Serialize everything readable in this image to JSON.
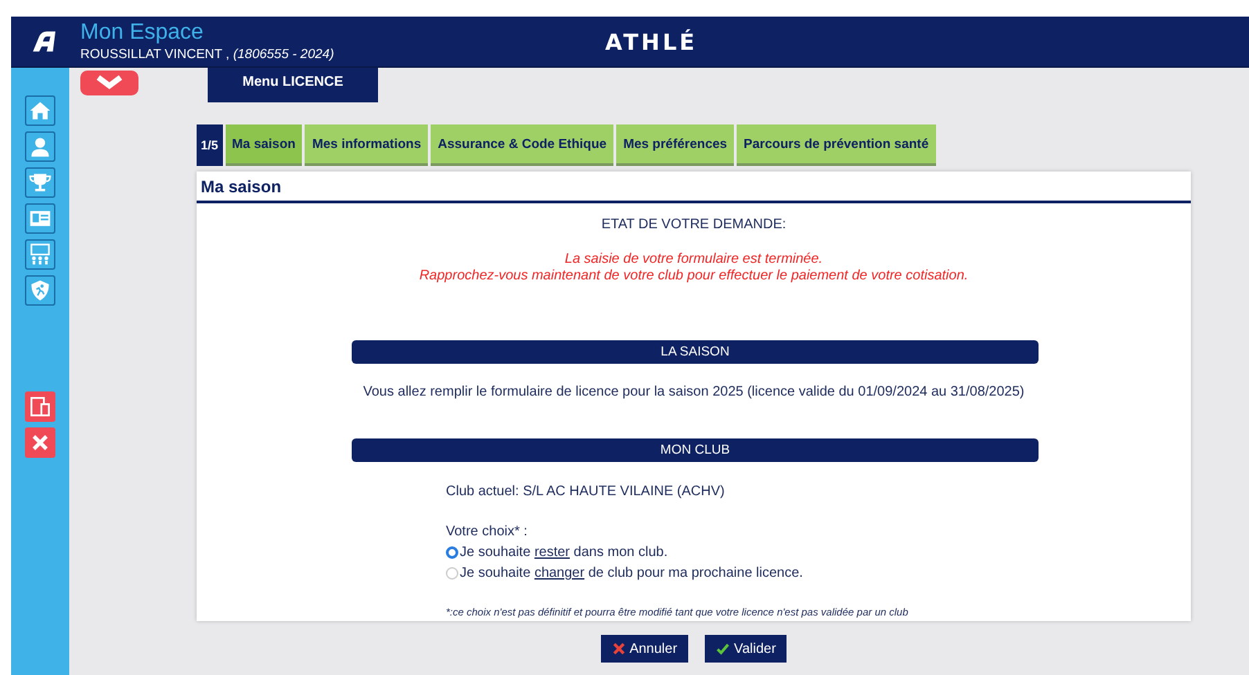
{
  "header": {
    "title": "Mon Espace",
    "user": "ROUSSILLAT VINCENT ,",
    "user_id": "(1806555 - 2024)",
    "logo": "ATHLÉ"
  },
  "menu_button": "Menu LICENCE",
  "step": "1/5",
  "tabs": [
    {
      "label": "Ma saison",
      "selected": true
    },
    {
      "label": "Mes informations",
      "selected": false
    },
    {
      "label": "Assurance & Code Ethique",
      "selected": false
    },
    {
      "label": "Mes préférences",
      "selected": false
    },
    {
      "label": "Parcours de prévention santé",
      "selected": false
    }
  ],
  "panel": {
    "title": "Ma saison",
    "status_heading": "ETAT DE VOTRE DEMANDE:",
    "status_lines": [
      "La saisie de votre formulaire est terminée.",
      "Rapprochez-vous maintenant de votre club pour effectuer le paiement de votre cotisation."
    ],
    "season_heading": "LA SAISON",
    "season_text": "Vous allez remplir le formulaire de licence pour la saison 2025 (licence valide du 01/09/2024 au 31/08/2025)",
    "club_heading": "MON CLUB",
    "current_club": "Club actuel: S/L AC HAUTE VILAINE (ACHV)",
    "choice_label": "Votre choix* :",
    "choices": [
      {
        "selected": true,
        "before": "Je souhaite ",
        "link": "rester",
        "after": " dans mon club."
      },
      {
        "selected": false,
        "before": "Je souhaite ",
        "link": "changer",
        "after": " de club pour ma prochaine licence."
      }
    ],
    "footnote": "*:ce choix n'est pas définitif et pourra être modifié tant que votre licence n'est pas validée par un club"
  },
  "buttons": [
    {
      "kind": "cancel",
      "label": "Annuler"
    },
    {
      "kind": "confirm",
      "label": "Valider"
    }
  ]
}
